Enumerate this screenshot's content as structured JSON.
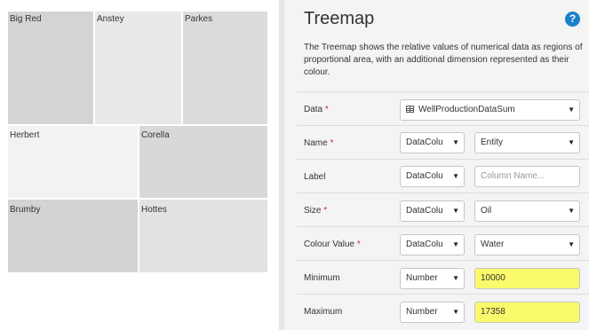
{
  "treemap": {
    "tiles": [
      {
        "label": "Big Red",
        "color": "#d4d4d4"
      },
      {
        "label": "Anstey",
        "color": "#e8e8e8"
      },
      {
        "label": "Parkes",
        "color": "#dcdcdc"
      },
      {
        "label": "Herbert",
        "color": "#f2f2f2"
      },
      {
        "label": "Corella",
        "color": "#d8d8d8"
      },
      {
        "label": "Brumby",
        "color": "#d3d3d3"
      },
      {
        "label": "Hottes",
        "color": "#e2e2e2"
      }
    ]
  },
  "panel": {
    "title": "Treemap",
    "help_icon": "?",
    "description": "The Treemap shows the relative values of numerical data as regions of proportional area, with an additional dimension represented as their colour.",
    "required_marker": "*",
    "rows": [
      {
        "label": "Data",
        "required": true,
        "dataset": {
          "value": "WellProductionDataSum",
          "icon": "table-grid-icon"
        }
      },
      {
        "label": "Name",
        "required": true,
        "type_select": "DataColu",
        "value_select": "Entity"
      },
      {
        "label": "Label",
        "required": false,
        "type_select": "DataColu",
        "value_placeholder": "Column Name..."
      },
      {
        "label": "Size",
        "required": true,
        "type_select": "DataColu",
        "value_select": "Oil"
      },
      {
        "label": "Colour Value",
        "required": true,
        "type_select": "DataColu",
        "value_select": "Water"
      },
      {
        "label": "Minimum",
        "required": false,
        "type_select": "Number",
        "value_input": "10000"
      },
      {
        "label": "Maximum",
        "required": false,
        "type_select": "Number",
        "value_input": "17358"
      }
    ]
  },
  "colors": {
    "accent_blue": "#1a82c8",
    "required_red": "#d9232e",
    "highlight_yellow": "#fbfa6c",
    "panel_bg": "#f4f4f4"
  }
}
